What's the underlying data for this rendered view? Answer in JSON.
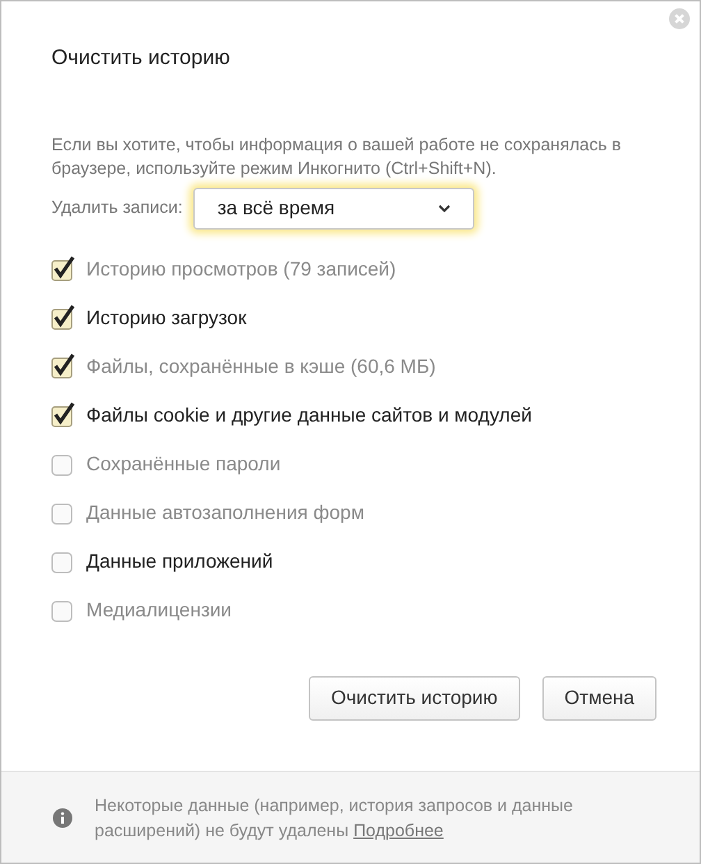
{
  "title": "Очистить историю",
  "notice": "Если вы хотите, чтобы информация о вашей работе не сохранялась в браузере, используйте режим Инкогнито (Ctrl+Shift+N).",
  "range": {
    "label": "Удалить записи:",
    "value": "за всё время"
  },
  "options": [
    {
      "label": "Историю просмотров (79 записей)",
      "checked": true,
      "disabled": true
    },
    {
      "label": "Историю загрузок",
      "checked": true,
      "disabled": false
    },
    {
      "label": "Файлы, сохранённые в кэше (60,6 МБ)",
      "checked": true,
      "disabled": true
    },
    {
      "label": "Файлы cookie и другие данные сайтов и модулей",
      "checked": true,
      "disabled": false
    },
    {
      "label": "Сохранённые пароли",
      "checked": false,
      "disabled": true
    },
    {
      "label": "Данные автозаполнения форм",
      "checked": false,
      "disabled": true
    },
    {
      "label": "Данные приложений",
      "checked": false,
      "disabled": false
    },
    {
      "label": "Медиалицензии",
      "checked": false,
      "disabled": true
    }
  ],
  "buttons": [
    "Очистить историю",
    "Отмена"
  ],
  "footer": {
    "text": "Некоторые данные (например, история запросов и данные расширений) не будут удалены",
    "link": "Подробнее"
  }
}
